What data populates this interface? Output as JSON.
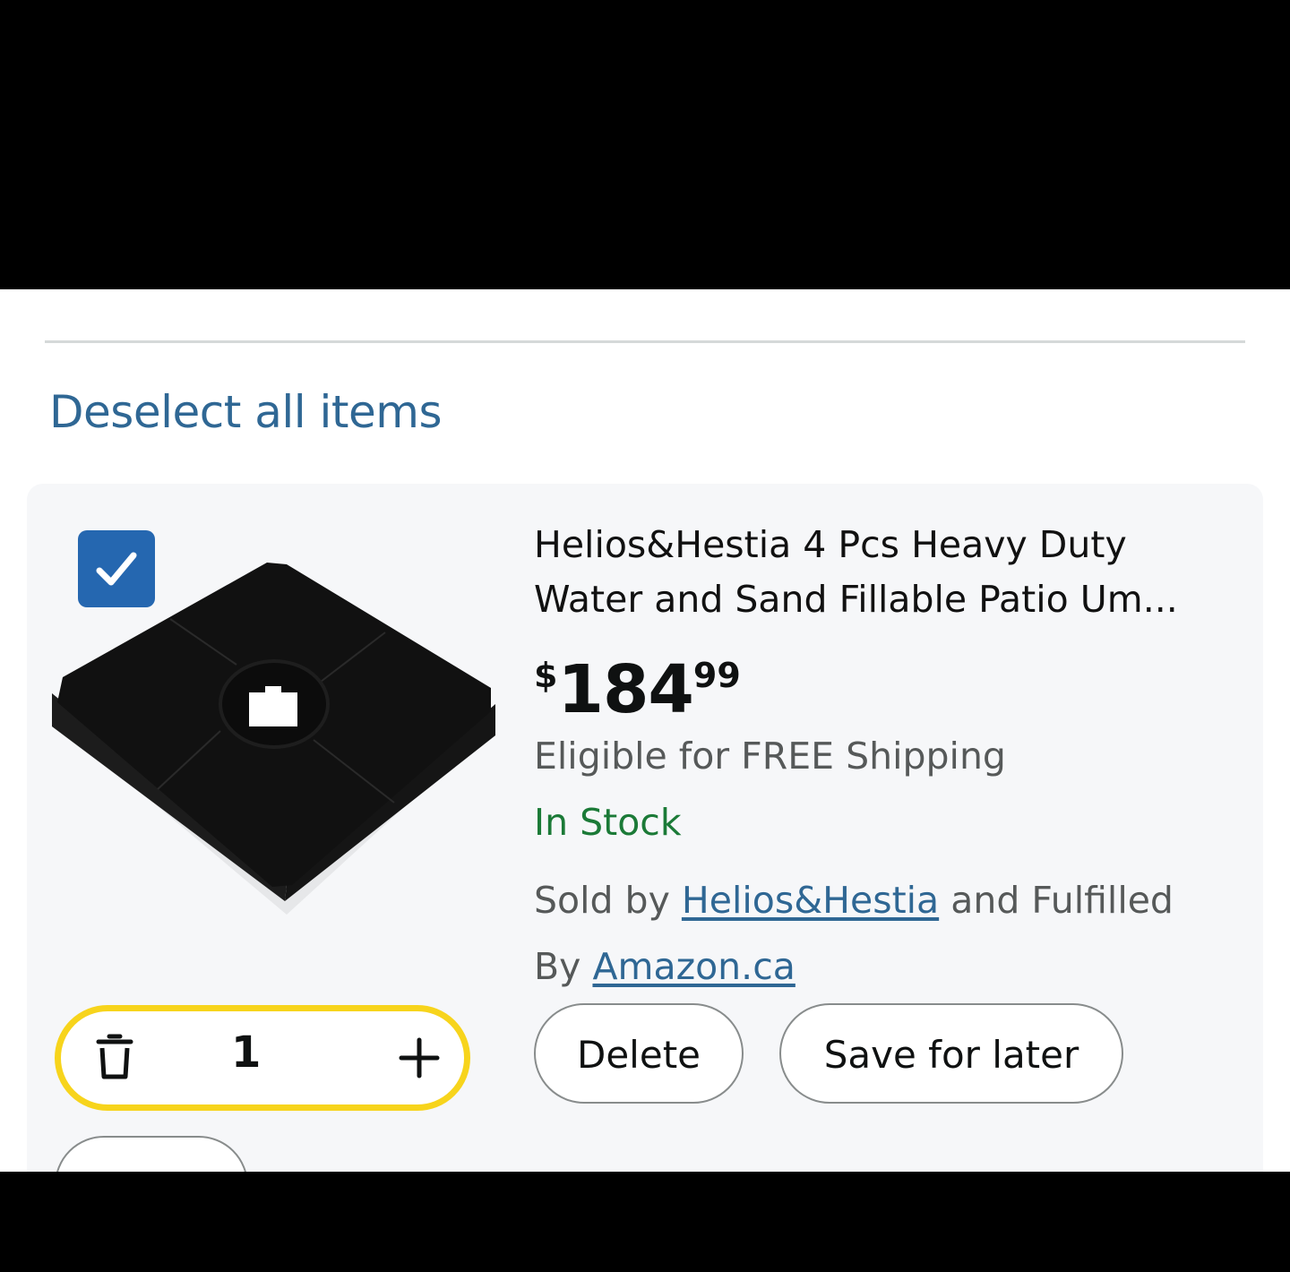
{
  "cart": {
    "deselect_label": "Deselect all items",
    "item": {
      "selected": true,
      "title_line1": "Helios&Hestia 4 Pcs Heavy Duty",
      "title_line2": "Water and Sand Fillable Patio Um...",
      "price": {
        "symbol": "$",
        "whole": "184",
        "fraction": "99"
      },
      "shipping_text": "Eligible for FREE Shipping",
      "stock_text": "In Stock",
      "seller_prefix": "Sold by",
      "seller_name": "Helios&Hestia",
      "fulfilled_middle": "and Fulfilled",
      "fulfilled_by_prefix": "By",
      "fulfilled_by_name": "Amazon.ca",
      "quantity": "1",
      "delete_label": "Delete",
      "save_later_label": "Save for later"
    }
  },
  "icons": {
    "checkbox": "checkmark-icon",
    "trash": "trash-icon",
    "plus": "plus-icon"
  },
  "colors": {
    "link": "#2f6794",
    "in_stock": "#1b7a37",
    "checkbox": "#2567b0",
    "stepper_border": "#f7d41c",
    "card_bg": "#f6f7f9"
  }
}
